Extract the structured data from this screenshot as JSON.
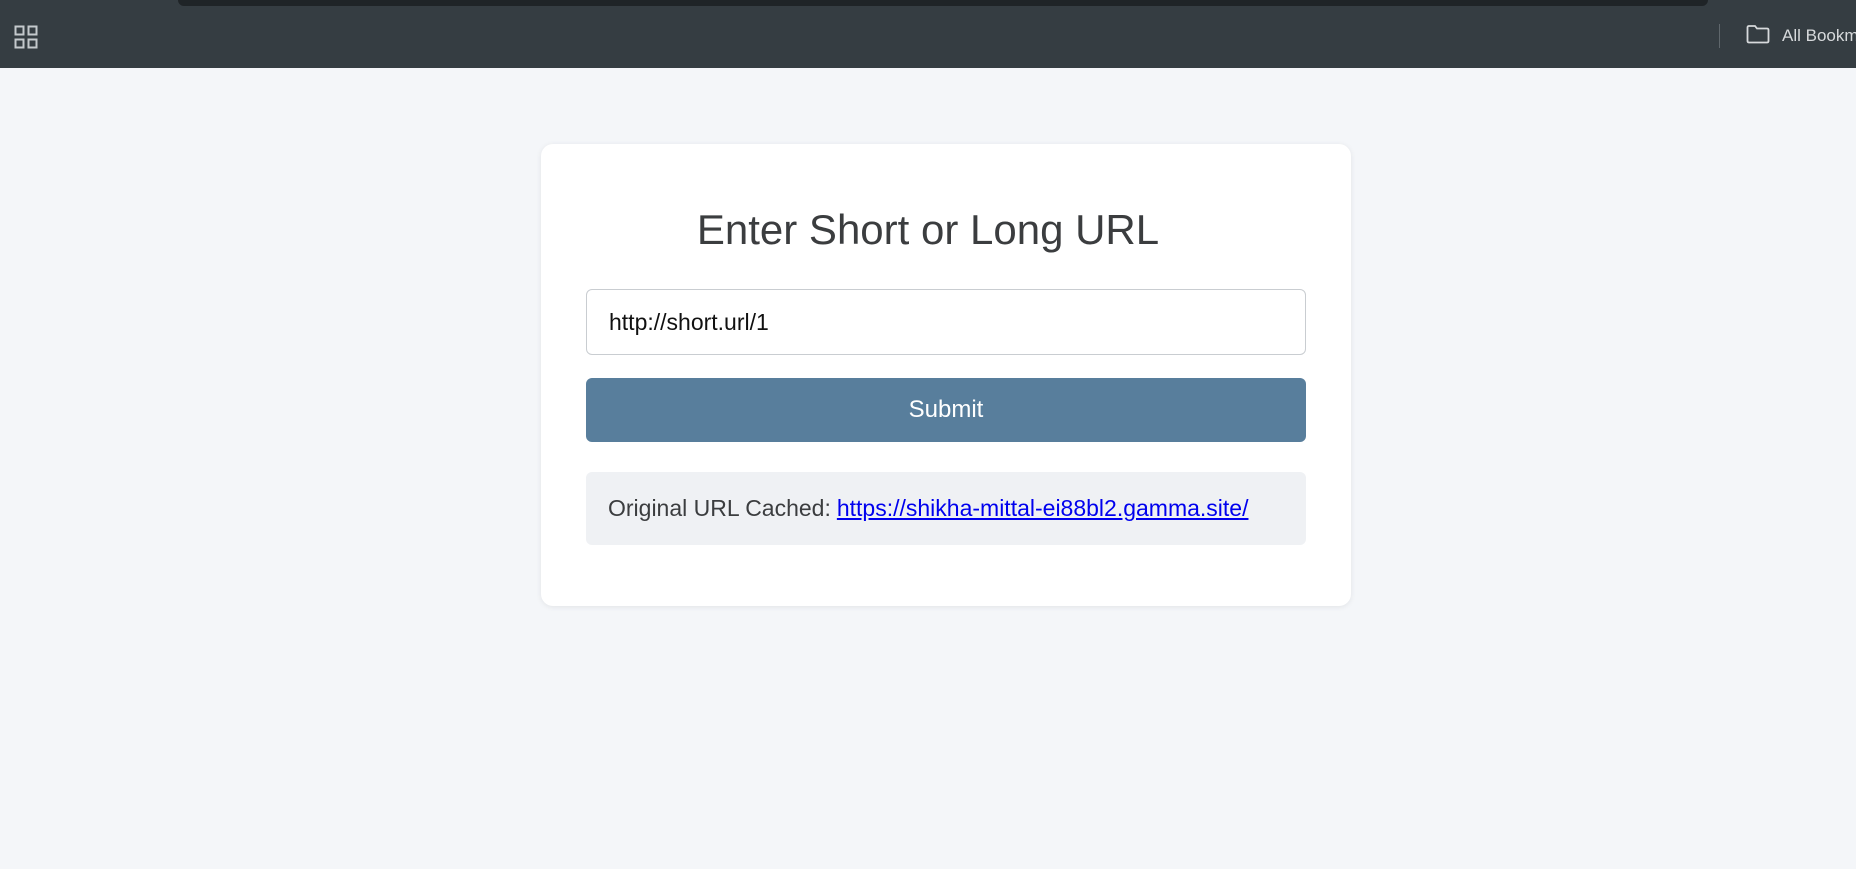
{
  "bookmarks_bar": {
    "apps_icon": "apps-grid-icon",
    "all_bookmarks_icon": "folder-icon",
    "all_bookmarks_label": "All Bookm"
  },
  "form": {
    "title": "Enter Short or Long URL",
    "input_value": "http://short.url/1",
    "submit_label": "Submit"
  },
  "result": {
    "label": "Original URL Cached:",
    "link_text": "https://shikha-mittal-ei88bl2.gamma.site/"
  },
  "colors": {
    "toolbar_background": "#353d42",
    "page_background": "#f4f6f9",
    "button_background": "#587e9c",
    "result_background": "#eff1f4",
    "link": "#0000ee"
  }
}
